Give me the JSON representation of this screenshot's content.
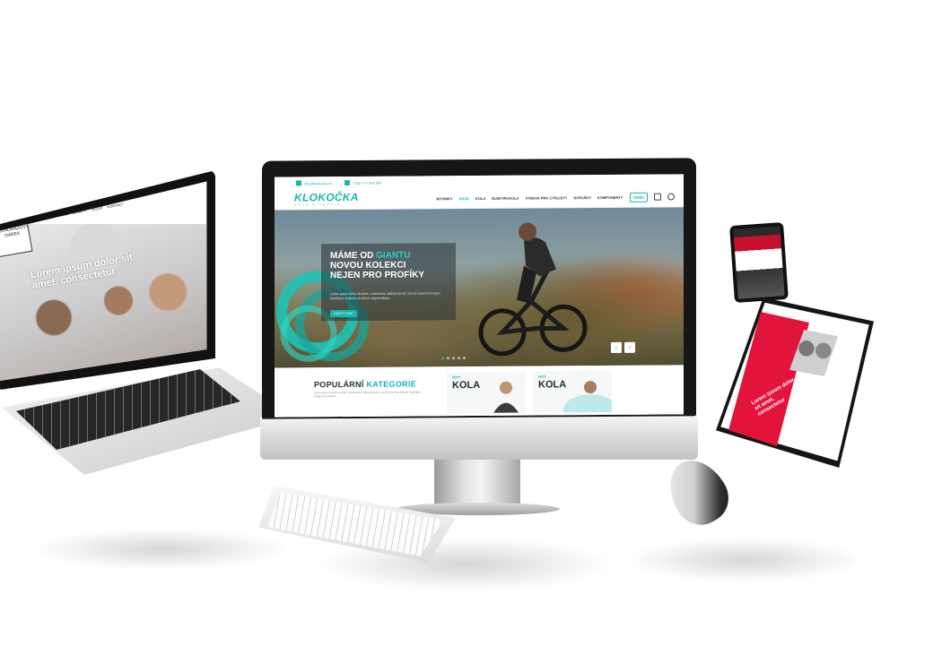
{
  "desktop_site": {
    "brand": {
      "name": "KLOKOČKA",
      "subline": "KOLA & SERVIS"
    },
    "topbar": {
      "email": "info@klokocka.cz",
      "phone": "+420 777 000 000"
    },
    "nav": {
      "items": [
        "NOVINKY",
        "AKCE",
        "KOLA",
        "ELEKTROKOLA",
        "VÝBAVA PRO CYKLISTY",
        "DOPLŇKY",
        "KOMPONENTY"
      ],
      "active_index": 1,
      "cta": "CENÍK"
    },
    "hero": {
      "title_line1_prefix": "MÁME OD ",
      "title_line1_accent": "GIANTU",
      "title_line2": "NOVOU KOLEKCI",
      "title_line3": "NEJEN PRO PROFÍKY",
      "body": "Lorem ipsum dolor sit amet, consectetur adipiscing elit, sed do eiusmod tempor incididunt ut labore et dolore magna aliqua.",
      "button": "ZJISTIT VÍCE",
      "arrow_prev": "‹",
      "arrow_next": "›"
    },
    "categories": {
      "title_prefix": "POPULÁRNÍ ",
      "title_accent": "KATEGORIE",
      "body": "Lorem ipsum dolor sit amet, consectetur adipiscing elit, sed do eiusmod tempor incididunt ut labore et dolore.",
      "cards": [
        {
          "kicker": "ŽENY",
          "title": "KOLA"
        },
        {
          "kicker": "MUŽI",
          "title": "KOLA"
        }
      ]
    }
  },
  "laptop_site": {
    "brand": "JEDNORÁZOVÝ DÁREK",
    "nav": [
      "ÚVODNÍ",
      "OFERTY",
      "SKLEP",
      "KONTAKT"
    ],
    "hero_text": "Lorem ipsum dolor sit amet, consectetur"
  },
  "tablet_site": {
    "heading": "Lorem ipsum dolor sit amet, consectetur"
  },
  "colors": {
    "accent": "#17b6ad",
    "tablet_accent": "#e2143c",
    "device_dark": "#161616"
  }
}
